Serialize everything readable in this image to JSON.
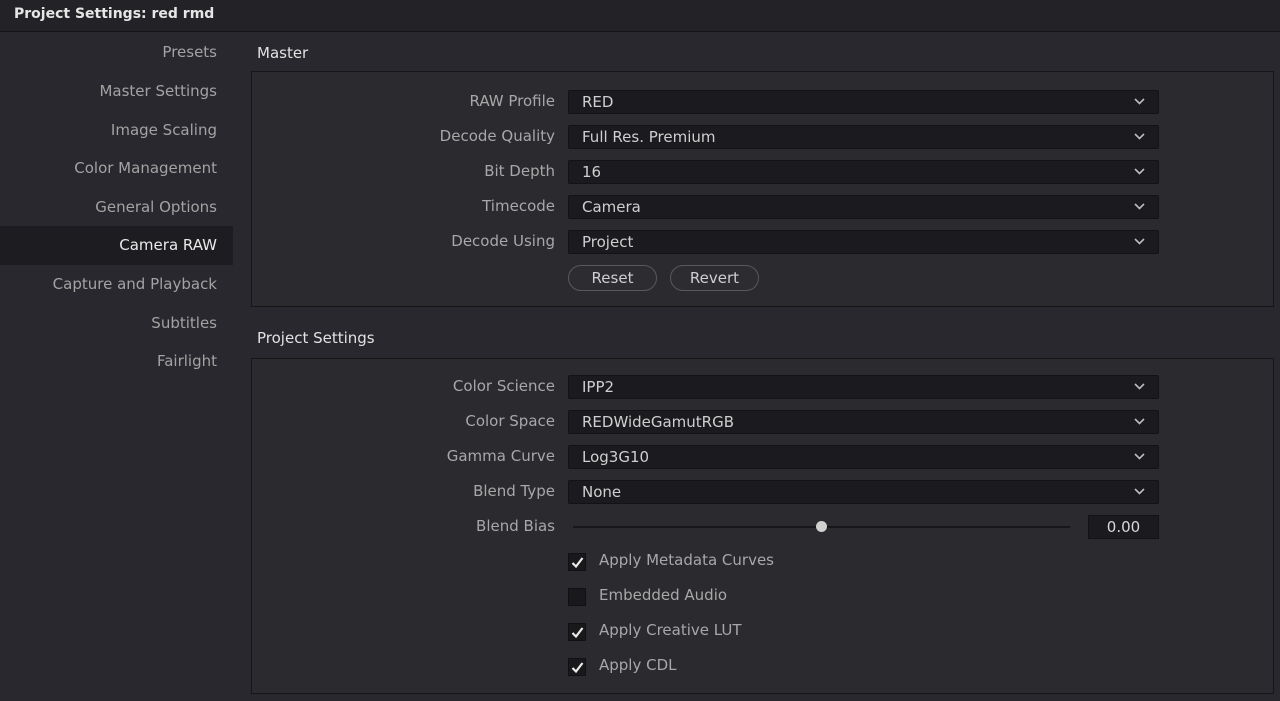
{
  "window": {
    "title": "Project Settings:  red rmd"
  },
  "sidebar": {
    "items": [
      {
        "label": "Presets"
      },
      {
        "label": "Master Settings"
      },
      {
        "label": "Image Scaling"
      },
      {
        "label": "Color Management"
      },
      {
        "label": "General Options"
      },
      {
        "label": "Camera RAW",
        "active": true
      },
      {
        "label": "Capture and Playback"
      },
      {
        "label": "Subtitles"
      },
      {
        "label": "Fairlight"
      }
    ]
  },
  "master": {
    "title": "Master",
    "fields": [
      {
        "label": "RAW Profile",
        "value": "RED"
      },
      {
        "label": "Decode Quality",
        "value": "Full Res. Premium"
      },
      {
        "label": "Bit Depth",
        "value": "16"
      },
      {
        "label": "Timecode",
        "value": "Camera"
      },
      {
        "label": "Decode Using",
        "value": "Project"
      }
    ],
    "reset_label": "Reset",
    "revert_label": "Revert"
  },
  "project_settings": {
    "title": "Project Settings",
    "fields": [
      {
        "label": "Color Science",
        "value": "IPP2"
      },
      {
        "label": "Color Space",
        "value": "REDWideGamutRGB"
      },
      {
        "label": "Gamma Curve",
        "value": "Log3G10"
      },
      {
        "label": "Blend Type",
        "value": "None"
      }
    ],
    "blend_bias": {
      "label": "Blend Bias",
      "value": "0.00",
      "level": 0.5
    },
    "checkboxes": [
      {
        "label": "Apply Metadata Curves",
        "checked": true
      },
      {
        "label": "Embedded Audio",
        "checked": false
      },
      {
        "label": "Apply Creative LUT",
        "checked": true
      },
      {
        "label": "Apply CDL",
        "checked": true
      }
    ]
  },
  "icons": {
    "dropdown": "chevron-down-icon",
    "check": "checkmark-icon"
  }
}
